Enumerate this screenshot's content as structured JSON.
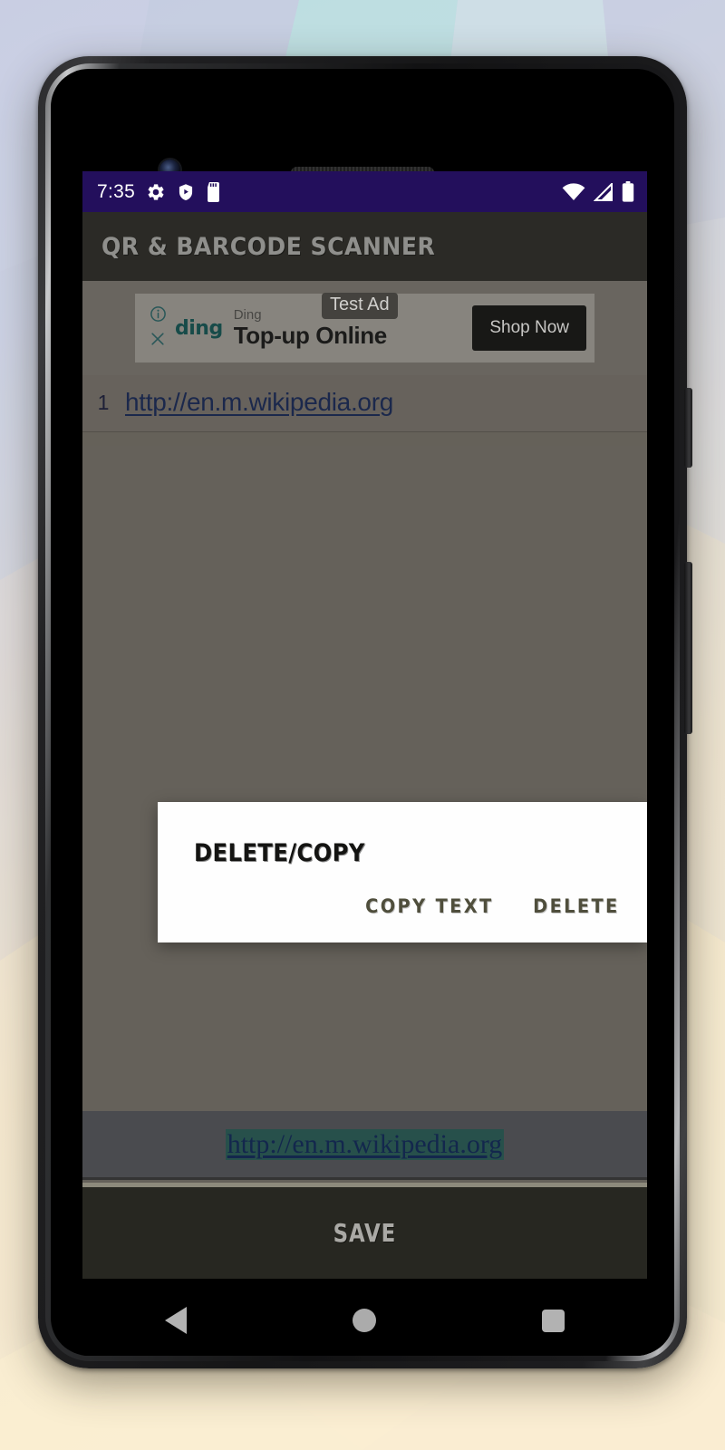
{
  "status_bar": {
    "time": "7:35",
    "left_icons": [
      "gear-icon",
      "shield-play-icon",
      "sd-card-icon"
    ],
    "right_icons": [
      "wifi-icon",
      "cell-signal-icon",
      "battery-icon"
    ],
    "background_color": "#230f5c"
  },
  "app_bar": {
    "title": "QR & BARCODE SCANNER",
    "background_color": "#2b2a26",
    "title_color": "#8f8f8c"
  },
  "ad": {
    "info_icon": "info-circle-icon",
    "close_icon": "close-x-icon",
    "brand": "ding",
    "advertiser": "Ding",
    "headline": "Top-up Online",
    "badge": "Test Ad",
    "cta": "Shop Now",
    "accent_color": "#184f4d"
  },
  "result_list": {
    "rows": [
      {
        "index": "1",
        "url": "http://en.m.wikipedia.org"
      }
    ],
    "link_color": "#1d2a50"
  },
  "bottom_url_bar": {
    "url": "http://en.m.wikipedia.org",
    "selection_color": "#27504b",
    "text_color": "#13274d"
  },
  "save_bar": {
    "label": "SAVE"
  },
  "dialog": {
    "title": "DELETE/COPY",
    "buttons": [
      {
        "label": "COPY TEXT",
        "name": "copy-text-button"
      },
      {
        "label": "DELETE",
        "name": "delete-button"
      }
    ],
    "button_color": "#4f4e3c",
    "background_color": "#fefefe"
  },
  "nav_bar": {
    "back": "back-triangle-icon",
    "home": "home-circle-icon",
    "recents": "recents-square-icon"
  }
}
